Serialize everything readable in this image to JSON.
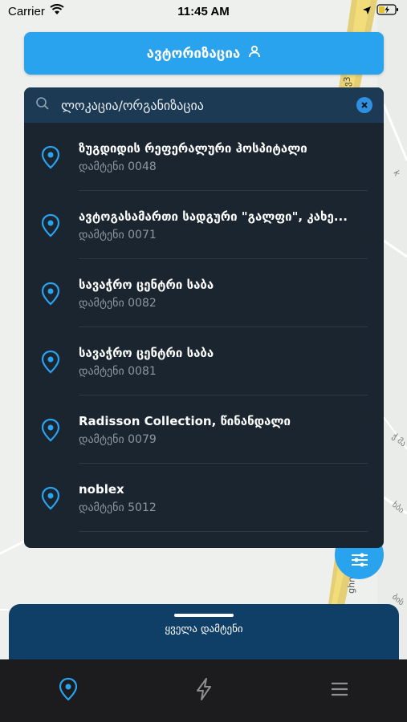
{
  "status_bar": {
    "carrier": "Carrier",
    "time": "11:45 AM"
  },
  "auth": {
    "label": "ავტორიზაცია"
  },
  "search": {
    "value": "ლოკაცია/ორგანიზაცია"
  },
  "results": [
    {
      "title": "ზუგდიდის რეფერალური ჰოსპიტალი",
      "subtitle": "დამტენი 0048"
    },
    {
      "title": "ავტოგასამართი სადგური \"გალფი\", კახე...",
      "subtitle": "დამტენი 0071"
    },
    {
      "title": "სავაჭრო ცენტრი საბა",
      "subtitle": "დამტენი 0082"
    },
    {
      "title": "სავაჭრო ცენტრი საბა",
      "subtitle": "დამტენი 0081"
    },
    {
      "title": "Radisson Collection, წინანდალი",
      "subtitle": "დამტენი 0079"
    },
    {
      "title": "noblex",
      "subtitle": "დამტენი 5012"
    }
  ],
  "bottom_sheet": {
    "label": "ყველა დამტენი"
  },
  "tabs": [
    "map-tab",
    "charging-tab",
    "menu-tab"
  ],
  "map_labels": {
    "road_vertical": "ghmashe",
    "road_code": "ვ3"
  },
  "colors": {
    "accent": "#2aa3ef",
    "panel": "#1a2530",
    "search_bar": "#1d3a55",
    "sheet": "#0f3e66",
    "tab_bar": "#1c1c1e"
  }
}
